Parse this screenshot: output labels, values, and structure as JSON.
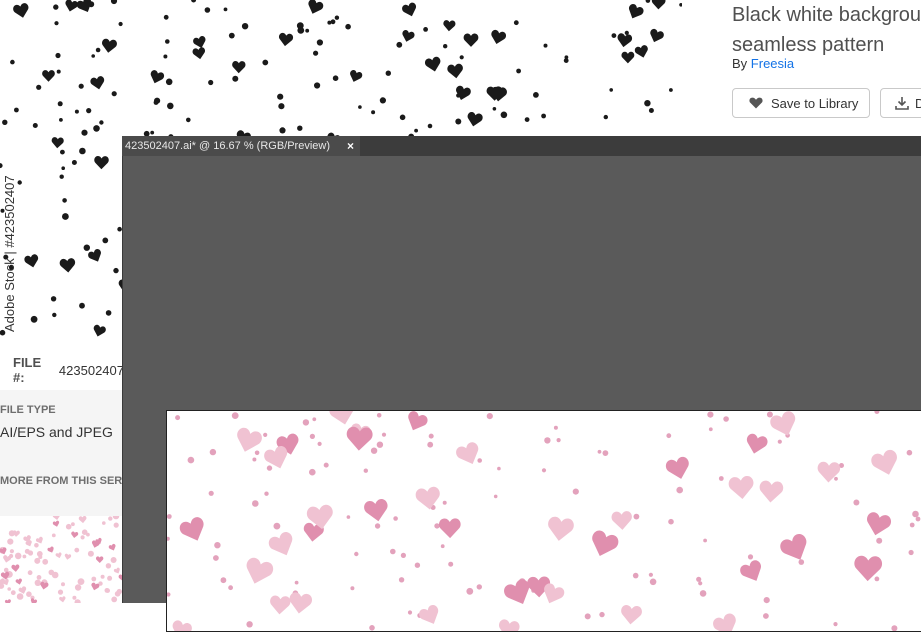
{
  "stock_page": {
    "title_line1": "Black white backgrour",
    "title_line2": "seamless pattern",
    "by_label": "By",
    "author": "Freesia",
    "save_button_label": "Save to Library",
    "download_button_label": "D",
    "watermark": "Adobe Stock | #423502407",
    "file_label": "FILE #:",
    "file_value": "423502407",
    "file_type_label": "FILE TYPE",
    "file_type_value": "AI/EPS and JPEG",
    "more_label": "MORE FROM THIS SERIES"
  },
  "illustrator": {
    "tab_title": "423502407.ai* @ 16.67 % (RGB/Preview)",
    "close_glyph": "×"
  },
  "colors": {
    "pattern_dark": "#1a1a1a",
    "heart_pink": "#e08fae",
    "heart_light": "#f0c2d2",
    "dot_pink": "#e3a2bc",
    "ai_background": "#5a5a5a",
    "link": "#1473e6"
  },
  "icons": {
    "save": "heart-icon",
    "download": "download-icon",
    "close": "close-icon"
  }
}
